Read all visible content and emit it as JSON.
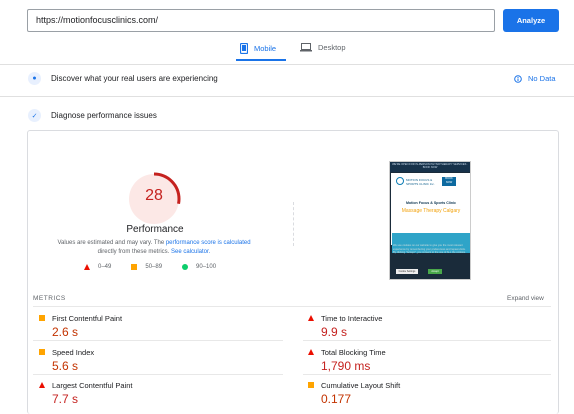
{
  "toolbar": {
    "url": "https://motionfocusclinics.com/",
    "analyze_label": "Analyze"
  },
  "tabs": [
    {
      "label": "Mobile",
      "active": true
    },
    {
      "label": "Desktop",
      "active": false
    }
  ],
  "field_section": {
    "title": "Discover what your real users are experiencing",
    "status": "No Data"
  },
  "lab_section": {
    "title": "Diagnose performance issues"
  },
  "score": {
    "value": "28",
    "fraction": 0.28,
    "label": "Performance",
    "color": "#c5221f"
  },
  "description": {
    "prefix": "Values are estimated and may vary. The",
    "link1": "performance score is calculated",
    "middle": "directly from these metrics.",
    "link2": "See calculator."
  },
  "legend": [
    {
      "shape": "triangle",
      "range": "0–49"
    },
    {
      "shape": "square",
      "range": "50–89"
    },
    {
      "shape": "circle",
      "range": "90–100"
    }
  ],
  "preview": {
    "topbar": "WE'RE OPEN FOR IN-PERSON PHYSIOTHERAPY SERVICES · BOOK NOW",
    "logo_text": "MOTION FOCUS & SPORTS CLINIC Inc.",
    "book": "BOOK NOW",
    "heading": "Motion Focus & Sports Clinic",
    "subheading": "Massage Therapy Calgary",
    "cookie_text": "We use cookies on our website to give you the most relevant experience by remembering your preferences and repeat visits. By clicking \"Accept\", you consent to the use of ALL the cookies.",
    "btn1": "Cookie Settings",
    "btn2": "Accept"
  },
  "metrics": {
    "header": "METRICS",
    "expand": "Expand view",
    "items": [
      {
        "label": "First Contentful Paint",
        "value": "2.6 s",
        "status": "average"
      },
      {
        "label": "Time to Interactive",
        "value": "9.9 s",
        "status": "fail"
      },
      {
        "label": "Speed Index",
        "value": "5.6 s",
        "status": "average"
      },
      {
        "label": "Total Blocking Time",
        "value": "1,790 ms",
        "status": "fail"
      },
      {
        "label": "Largest Contentful Paint",
        "value": "7.7 s",
        "status": "fail"
      },
      {
        "label": "Cumulative Layout Shift",
        "value": "0.177",
        "status": "average"
      }
    ]
  },
  "icons": {
    "mobile": "phone-icon",
    "desktop": "laptop-icon",
    "field": "users-icon",
    "lab": "flask-icon",
    "info": "info-icon"
  }
}
